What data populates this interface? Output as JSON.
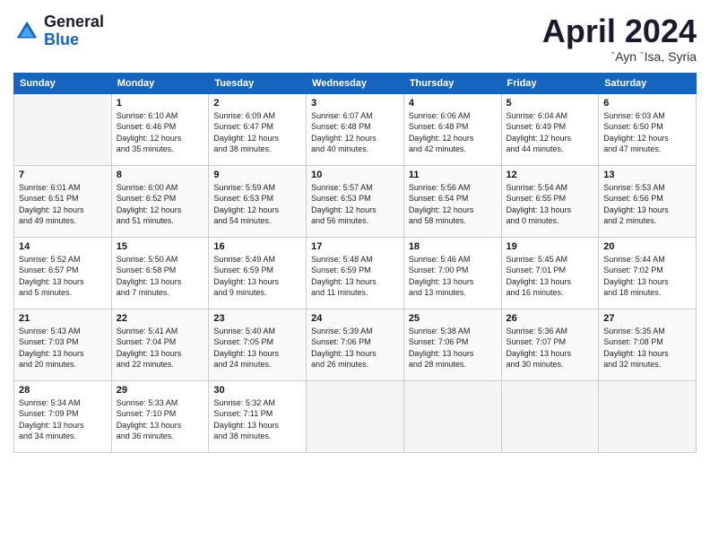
{
  "logo": {
    "line1": "General",
    "line2": "Blue"
  },
  "title": "April 2024",
  "subtitle": "`Ayn `Isa, Syria",
  "days_of_week": [
    "Sunday",
    "Monday",
    "Tuesday",
    "Wednesday",
    "Thursday",
    "Friday",
    "Saturday"
  ],
  "weeks": [
    [
      {
        "day": "",
        "info": ""
      },
      {
        "day": "1",
        "info": "Sunrise: 6:10 AM\nSunset: 6:46 PM\nDaylight: 12 hours\nand 35 minutes."
      },
      {
        "day": "2",
        "info": "Sunrise: 6:09 AM\nSunset: 6:47 PM\nDaylight: 12 hours\nand 38 minutes."
      },
      {
        "day": "3",
        "info": "Sunrise: 6:07 AM\nSunset: 6:48 PM\nDaylight: 12 hours\nand 40 minutes."
      },
      {
        "day": "4",
        "info": "Sunrise: 6:06 AM\nSunset: 6:48 PM\nDaylight: 12 hours\nand 42 minutes."
      },
      {
        "day": "5",
        "info": "Sunrise: 6:04 AM\nSunset: 6:49 PM\nDaylight: 12 hours\nand 44 minutes."
      },
      {
        "day": "6",
        "info": "Sunrise: 6:03 AM\nSunset: 6:50 PM\nDaylight: 12 hours\nand 47 minutes."
      }
    ],
    [
      {
        "day": "7",
        "info": "Sunrise: 6:01 AM\nSunset: 6:51 PM\nDaylight: 12 hours\nand 49 minutes."
      },
      {
        "day": "8",
        "info": "Sunrise: 6:00 AM\nSunset: 6:52 PM\nDaylight: 12 hours\nand 51 minutes."
      },
      {
        "day": "9",
        "info": "Sunrise: 5:59 AM\nSunset: 6:53 PM\nDaylight: 12 hours\nand 54 minutes."
      },
      {
        "day": "10",
        "info": "Sunrise: 5:57 AM\nSunset: 6:53 PM\nDaylight: 12 hours\nand 56 minutes."
      },
      {
        "day": "11",
        "info": "Sunrise: 5:56 AM\nSunset: 6:54 PM\nDaylight: 12 hours\nand 58 minutes."
      },
      {
        "day": "12",
        "info": "Sunrise: 5:54 AM\nSunset: 6:55 PM\nDaylight: 13 hours\nand 0 minutes."
      },
      {
        "day": "13",
        "info": "Sunrise: 5:53 AM\nSunset: 6:56 PM\nDaylight: 13 hours\nand 2 minutes."
      }
    ],
    [
      {
        "day": "14",
        "info": "Sunrise: 5:52 AM\nSunset: 6:57 PM\nDaylight: 13 hours\nand 5 minutes."
      },
      {
        "day": "15",
        "info": "Sunrise: 5:50 AM\nSunset: 6:58 PM\nDaylight: 13 hours\nand 7 minutes."
      },
      {
        "day": "16",
        "info": "Sunrise: 5:49 AM\nSunset: 6:59 PM\nDaylight: 13 hours\nand 9 minutes."
      },
      {
        "day": "17",
        "info": "Sunrise: 5:48 AM\nSunset: 6:59 PM\nDaylight: 13 hours\nand 11 minutes."
      },
      {
        "day": "18",
        "info": "Sunrise: 5:46 AM\nSunset: 7:00 PM\nDaylight: 13 hours\nand 13 minutes."
      },
      {
        "day": "19",
        "info": "Sunrise: 5:45 AM\nSunset: 7:01 PM\nDaylight: 13 hours\nand 16 minutes."
      },
      {
        "day": "20",
        "info": "Sunrise: 5:44 AM\nSunset: 7:02 PM\nDaylight: 13 hours\nand 18 minutes."
      }
    ],
    [
      {
        "day": "21",
        "info": "Sunrise: 5:43 AM\nSunset: 7:03 PM\nDaylight: 13 hours\nand 20 minutes."
      },
      {
        "day": "22",
        "info": "Sunrise: 5:41 AM\nSunset: 7:04 PM\nDaylight: 13 hours\nand 22 minutes."
      },
      {
        "day": "23",
        "info": "Sunrise: 5:40 AM\nSunset: 7:05 PM\nDaylight: 13 hours\nand 24 minutes."
      },
      {
        "day": "24",
        "info": "Sunrise: 5:39 AM\nSunset: 7:06 PM\nDaylight: 13 hours\nand 26 minutes."
      },
      {
        "day": "25",
        "info": "Sunrise: 5:38 AM\nSunset: 7:06 PM\nDaylight: 13 hours\nand 28 minutes."
      },
      {
        "day": "26",
        "info": "Sunrise: 5:36 AM\nSunset: 7:07 PM\nDaylight: 13 hours\nand 30 minutes."
      },
      {
        "day": "27",
        "info": "Sunrise: 5:35 AM\nSunset: 7:08 PM\nDaylight: 13 hours\nand 32 minutes."
      }
    ],
    [
      {
        "day": "28",
        "info": "Sunrise: 5:34 AM\nSunset: 7:09 PM\nDaylight: 13 hours\nand 34 minutes."
      },
      {
        "day": "29",
        "info": "Sunrise: 5:33 AM\nSunset: 7:10 PM\nDaylight: 13 hours\nand 36 minutes."
      },
      {
        "day": "30",
        "info": "Sunrise: 5:32 AM\nSunset: 7:11 PM\nDaylight: 13 hours\nand 38 minutes."
      },
      {
        "day": "",
        "info": ""
      },
      {
        "day": "",
        "info": ""
      },
      {
        "day": "",
        "info": ""
      },
      {
        "day": "",
        "info": ""
      }
    ]
  ]
}
